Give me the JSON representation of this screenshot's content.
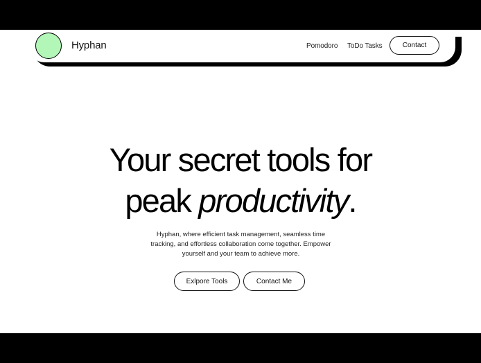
{
  "header": {
    "brand": "Hyphan",
    "nav_links": [
      "Pomodoro",
      "ToDo Tasks"
    ],
    "contact_label": "Contact"
  },
  "hero": {
    "title_line1": "Your secret tools for",
    "title_line2_prefix": "peak ",
    "title_line2_italic": "productivity",
    "title_line2_suffix": ".",
    "description": "Hyphan, where efficient task management, seamless time tracking, and effortless collaboration come together. Empower yourself and your team to achieve more.",
    "explore_label": "Exlpore Tools",
    "contact_label": "Contact Me"
  },
  "colors": {
    "logo_circle": "#b2f7b8",
    "frame": "#000000",
    "background": "#ffffff"
  }
}
